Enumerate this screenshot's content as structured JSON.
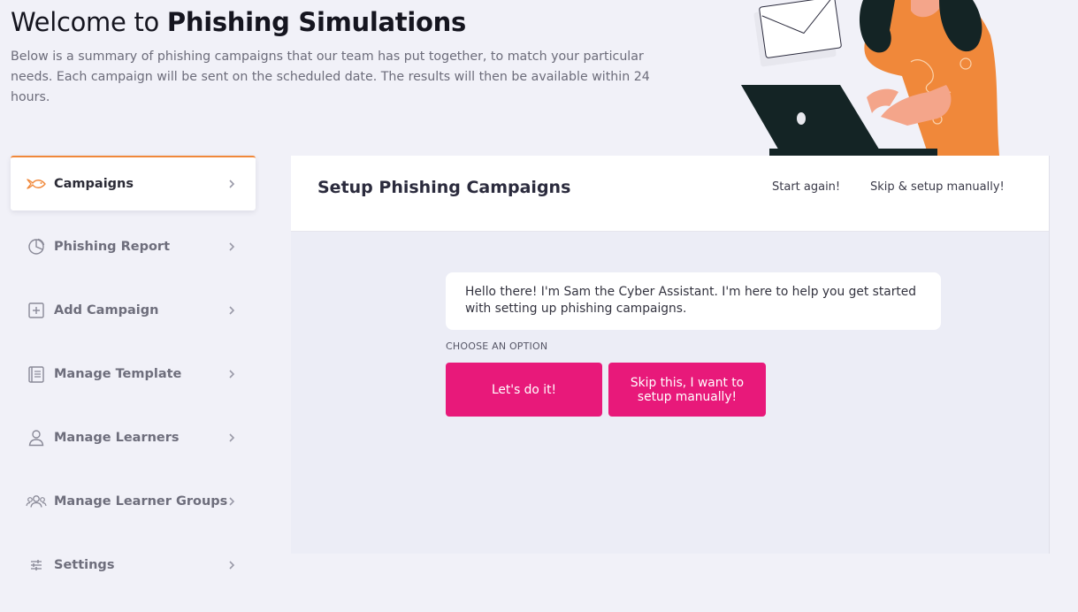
{
  "header": {
    "title_prefix": "Welcome to ",
    "title_bold": "Phishing Simulations",
    "intro": "Below is a summary of phishing campaigns that our team has put together, to match your particular needs. Each campaign will be sent on the scheduled date. The results will then be available within 24 hours."
  },
  "sidebar": {
    "items": [
      {
        "label": "Campaigns",
        "icon": "fish-icon",
        "active": true
      },
      {
        "label": "Phishing Report",
        "icon": "pie-chart-icon"
      },
      {
        "label": "Add Campaign",
        "icon": "plus-square-icon"
      },
      {
        "label": "Manage Template",
        "icon": "template-icon"
      },
      {
        "label": "Manage Learners",
        "icon": "user-icon"
      },
      {
        "label": "Manage Learner Groups",
        "icon": "users-icon"
      },
      {
        "label": "Settings",
        "icon": "sliders-icon"
      }
    ]
  },
  "panel": {
    "title": "Setup Phishing Campaigns",
    "start_again": "Start again!",
    "skip_link": "Skip & setup manually!",
    "message": "Hello there! I'm Sam the Cyber Assistant. I'm here to help you get started with setting up phishing campaigns.",
    "choose_label": "CHOOSE AN OPTION",
    "option_yes": "Let's do it!",
    "option_skip": "Skip this, I want to setup manually!"
  },
  "colors": {
    "accent": "#e8197a",
    "active_border": "#f0883a",
    "background": "#f1f1f8"
  }
}
